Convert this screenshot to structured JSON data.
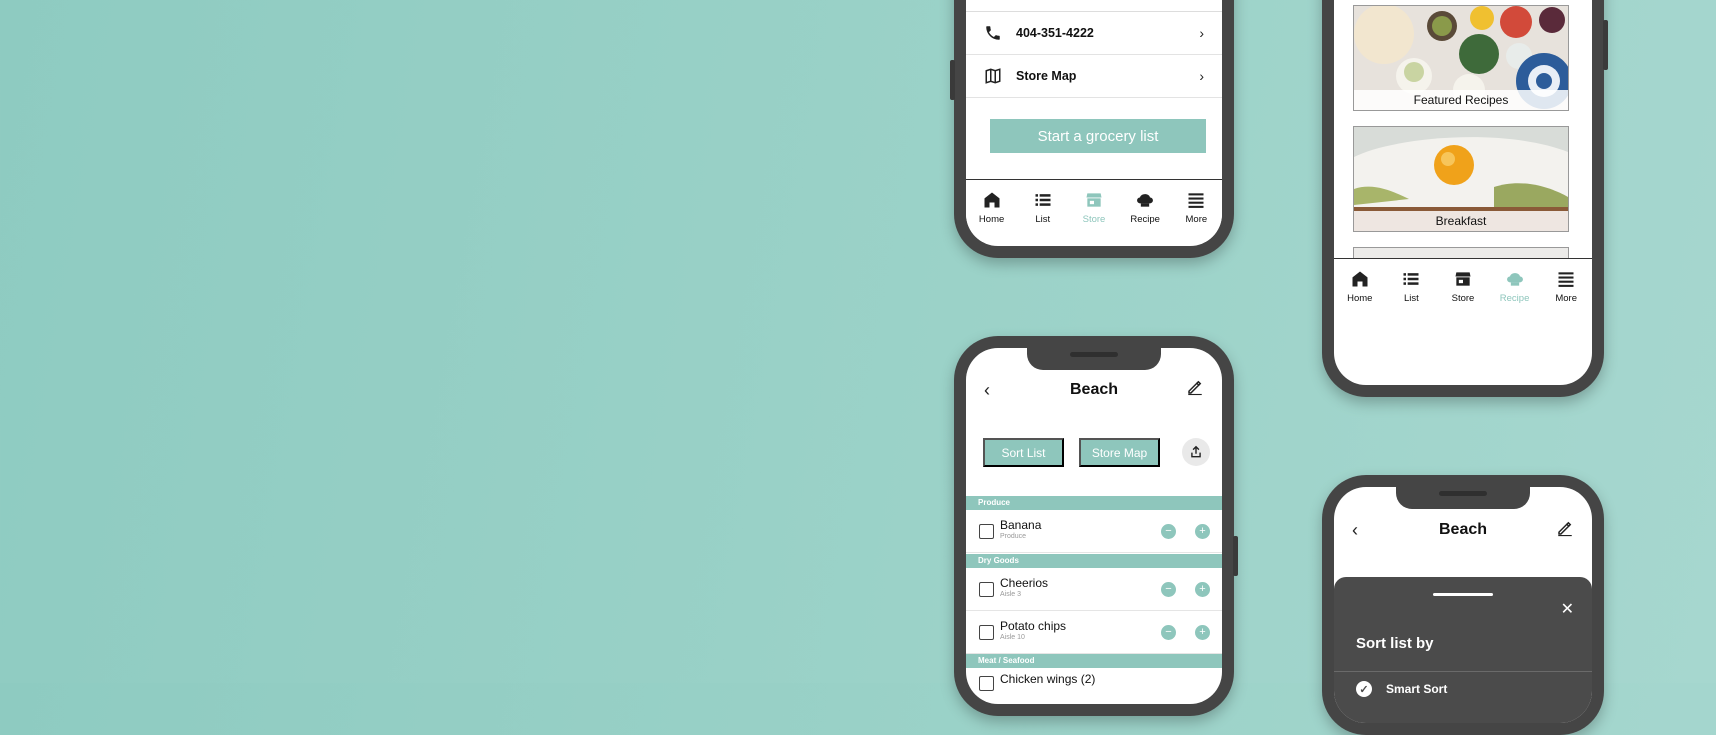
{
  "store_screen": {
    "phone": "404-351-4222",
    "store_map": "Store Map",
    "start_button": "Start a grocery list",
    "tabs": [
      {
        "label": "Home",
        "icon": "home-icon"
      },
      {
        "label": "List",
        "icon": "list-icon"
      },
      {
        "label": "Store",
        "icon": "store-icon",
        "active": true
      },
      {
        "label": "Recipe",
        "icon": "chef-hat-icon"
      },
      {
        "label": "More",
        "icon": "menu-icon"
      }
    ]
  },
  "recipe_screen": {
    "cards": [
      {
        "label": "Featured Recipes"
      },
      {
        "label": "Breakfast"
      },
      {
        "label": ""
      }
    ],
    "tabs": [
      {
        "label": "Home",
        "icon": "home-icon"
      },
      {
        "label": "List",
        "icon": "list-icon"
      },
      {
        "label": "Store",
        "icon": "store-icon"
      },
      {
        "label": "Recipe",
        "icon": "chef-hat-icon",
        "active": true
      },
      {
        "label": "More",
        "icon": "menu-icon"
      }
    ]
  },
  "list_screen": {
    "title": "Beach",
    "sort_button": "Sort List",
    "map_button": "Store Map",
    "sections": [
      {
        "name": "Produce",
        "items": [
          {
            "name": "Banana",
            "sub": "Produce"
          }
        ]
      },
      {
        "name": "Dry Goods",
        "items": [
          {
            "name": "Cheerios",
            "sub": "Aisle 3"
          },
          {
            "name": "Potato chips",
            "sub": "Aisle 10"
          }
        ]
      },
      {
        "name": "Meat / Seafood",
        "items": []
      }
    ],
    "partial_item": "Chicken wings (2)"
  },
  "sort_screen": {
    "title": "Beach",
    "sheet_title": "Sort list by",
    "option": "Smart Sort"
  },
  "colors": {
    "accent": "#8ec6bc",
    "background": "#9bd2c8",
    "phone": "#454545"
  }
}
